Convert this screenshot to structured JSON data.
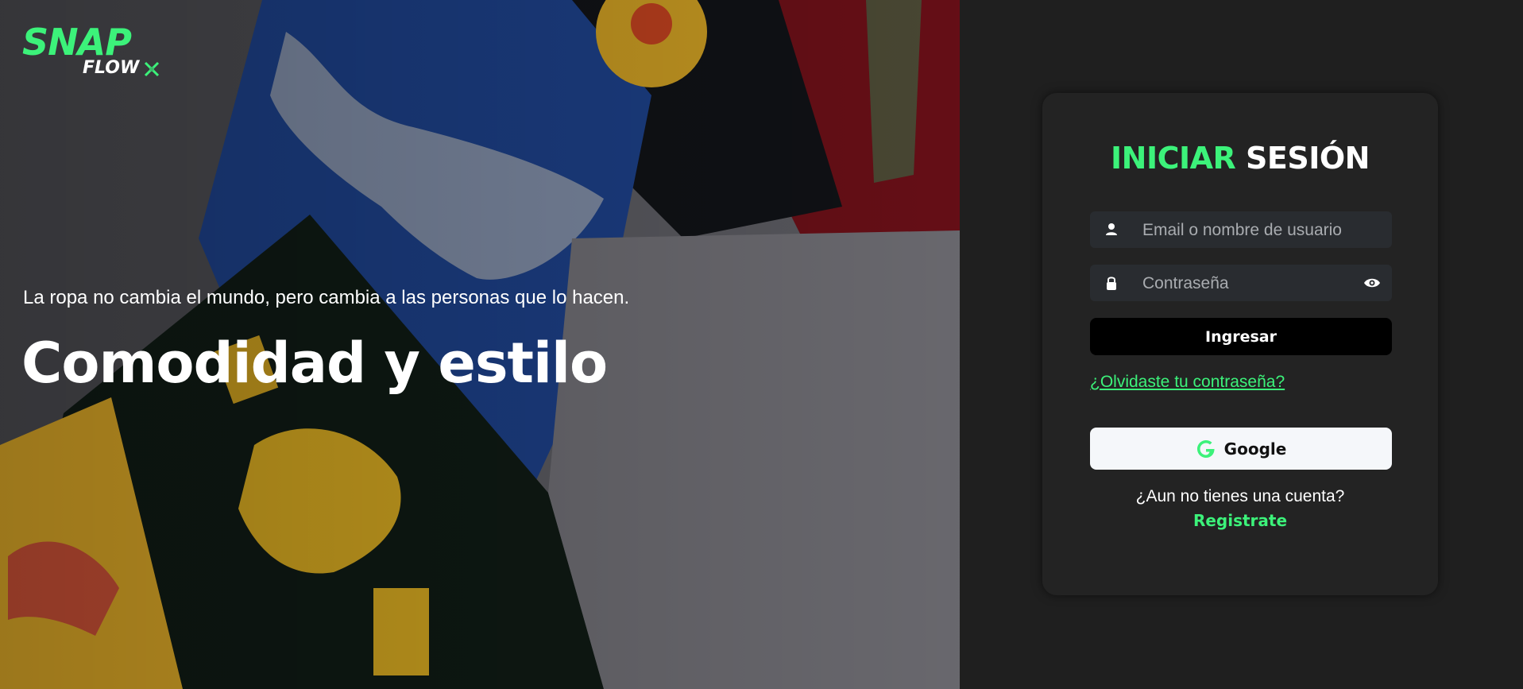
{
  "brand": {
    "logo_top": "SNAP",
    "logo_bottom": "FLOW",
    "accent_color": "#3cf27a"
  },
  "hero": {
    "tagline": "La ropa no cambia el mundo, pero cambia a las personas que lo hacen.",
    "headline": "Comodidad y estilo",
    "image_subject": "folded graphic t-shirts"
  },
  "login": {
    "title_part1": "INICIAR",
    "title_part2": "SESIÓN",
    "email_placeholder": "Email o nombre de usuario",
    "password_placeholder": "Contraseña",
    "email_icon": "user-icon",
    "password_icon": "lock-icon",
    "toggle_icon": "eye-icon",
    "submit_label": "Ingresar",
    "forgot_label": "¿Olvidaste tu contraseña?",
    "google_label": "Google",
    "no_account_text": "¿Aun no tienes una cuenta?",
    "register_label": "Registrate"
  }
}
